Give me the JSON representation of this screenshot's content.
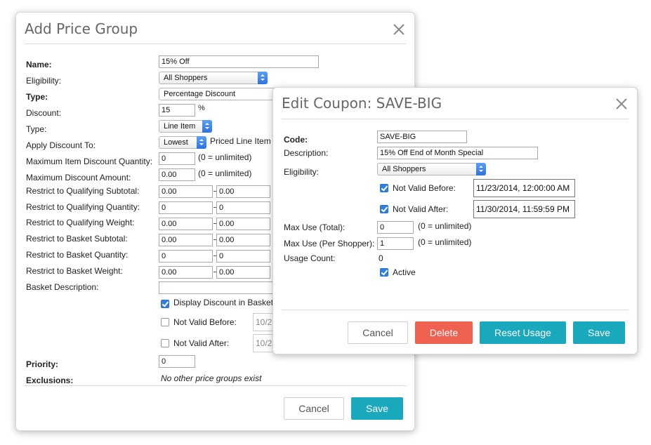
{
  "price_group": {
    "title": "Add Price Group",
    "labels": {
      "name": "Name:",
      "eligibility": "Eligibility:",
      "type": "Type:",
      "discount": "Discount:",
      "type2": "Type:",
      "apply_to": "Apply Discount To:",
      "max_item_qty": "Maximum Item Discount Quantity:",
      "max_amount": "Maximum Discount Amount:",
      "qual_subtotal": "Restrict to Qualifying Subtotal:",
      "qual_qty": "Restrict to Qualifying Quantity:",
      "qual_weight": "Restrict to Qualifying Weight:",
      "basket_subtotal": "Restrict to Basket Subtotal:",
      "basket_qty": "Restrict to Basket Quantity:",
      "basket_weight": "Restrict to Basket Weight:",
      "basket_desc": "Basket Description:",
      "priority": "Priority:",
      "exclusions": "Exclusions:"
    },
    "name_value": "15% Off",
    "eligibility_value": "All Shoppers",
    "type_value": "Percentage Discount",
    "discount_value": "15",
    "discount_unit": "%",
    "type2_value": "Line Item",
    "apply_to_value": "Lowest",
    "apply_to_suffix": "Priced Line Item",
    "max_item_qty_value": "0",
    "max_item_qty_note": "(0 = unlimited)",
    "max_amount_value": "0.00",
    "max_amount_note": "(0 = unlimited)",
    "qual_subtotal_min": "0.00",
    "qual_subtotal_max": "0.00",
    "qual_qty_min": "0",
    "qual_qty_max": "0",
    "qual_weight_min": "0.00",
    "qual_weight_max": "0.00",
    "basket_subtotal_min": "0.00",
    "basket_subtotal_max": "0.00",
    "basket_qty_min": "0",
    "basket_qty_max": "0",
    "basket_weight_min": "0.00",
    "basket_weight_max": "0.00",
    "basket_desc_value": "",
    "display_discount_label": "Display Discount in Basket",
    "display_discount_checked": true,
    "not_valid_before_label": "Not Valid Before:",
    "not_valid_before_value": "10/2",
    "not_valid_after_label": "Not Valid After:",
    "not_valid_after_value": "10/2",
    "priority_value": "0",
    "exclusions_value": "No other price groups exist",
    "cancel_label": "Cancel",
    "save_label": "Save"
  },
  "coupon": {
    "title": "Edit Coupon: SAVE-BIG",
    "labels": {
      "code": "Code:",
      "description": "Description:",
      "eligibility": "Eligibility:",
      "not_valid_before": "Not Valid Before:",
      "not_valid_after": "Not Valid After:",
      "max_use_total": "Max Use (Total):",
      "max_use_shopper": "Max Use (Per Shopper):",
      "usage_count": "Usage Count:",
      "active": "Active"
    },
    "code_value": "SAVE-BIG",
    "description_value": "15% Off End of Month Special",
    "eligibility_value": "All Shoppers",
    "not_valid_before_value": "11/23/2014, 12:00:00 AM",
    "not_valid_after_value": "11/30/2014, 11:59:59 PM",
    "max_use_total_value": "0",
    "max_use_total_note": "(0 = unlimited)",
    "max_use_shopper_value": "1",
    "max_use_shopper_note": "(0 = unlimited)",
    "usage_count_value": "0",
    "cancel_label": "Cancel",
    "delete_label": "Delete",
    "reset_label": "Reset Usage",
    "save_label": "Save"
  },
  "colors": {
    "primary": "#1aa8bd",
    "danger": "#f06050",
    "checkbox": "#2f7fe6"
  }
}
